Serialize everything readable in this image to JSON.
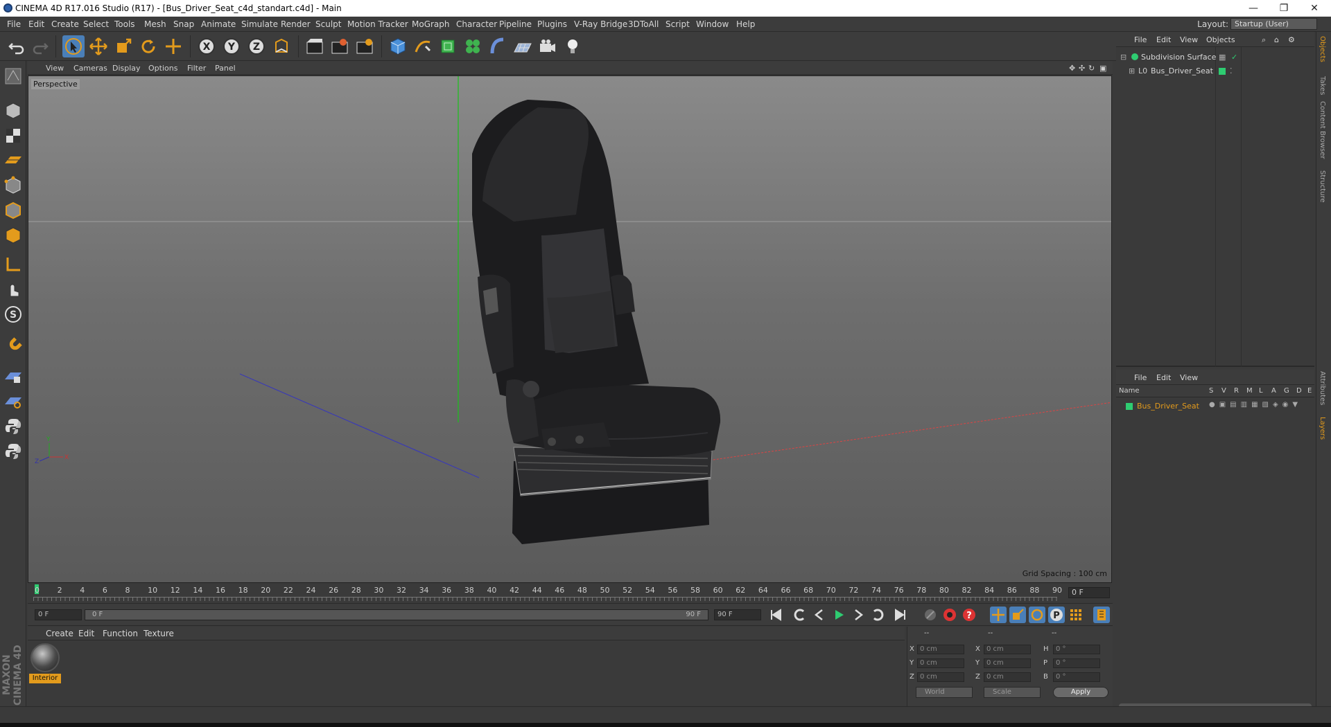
{
  "window": {
    "title": "CINEMA 4D R17.016 Studio (R17) - [Bus_Driver_Seat_c4d_standart.c4d] - Main",
    "minimize": "—",
    "maximize": "❐",
    "close": "✕"
  },
  "menubar": {
    "items": [
      "File",
      "Edit",
      "Create",
      "Select",
      "Tools",
      "Mesh",
      "Snap",
      "Animate",
      "Simulate",
      "Render",
      "Sculpt",
      "Motion Tracker",
      "MoGraph",
      "Character",
      "Pipeline",
      "Plugins",
      "V-Ray Bridge",
      "3DToAll",
      "Script",
      "Window",
      "Help"
    ],
    "layout_label": "Layout:",
    "layout_value": "Startup (User)"
  },
  "viewport": {
    "menu": [
      "View",
      "Cameras",
      "Display",
      "Options",
      "Filter",
      "Panel"
    ],
    "label": "Perspective",
    "grid_spacing": "Grid Spacing : 100 cm",
    "axis_labels": {
      "x": "X",
      "y": "Y",
      "z": "Z"
    }
  },
  "timeline": {
    "ticks": [
      "0",
      "2",
      "4",
      "6",
      "8",
      "10",
      "12",
      "14",
      "16",
      "18",
      "20",
      "22",
      "24",
      "26",
      "28",
      "30",
      "32",
      "34",
      "36",
      "38",
      "40",
      "42",
      "44",
      "46",
      "48",
      "50",
      "52",
      "54",
      "56",
      "58",
      "60",
      "62",
      "64",
      "66",
      "68",
      "70",
      "72",
      "74",
      "76",
      "78",
      "80",
      "82",
      "84",
      "86",
      "88",
      "90"
    ],
    "current_frame": "0 F"
  },
  "transport": {
    "start_field": "0 F",
    "slider_start": "0 F",
    "slider_end": "90 F",
    "end_field": "90 F"
  },
  "material_manager": {
    "menu": [
      "Create",
      "Edit",
      "Function",
      "Texture"
    ],
    "materials": [
      {
        "name": "Interior"
      }
    ]
  },
  "coordinates": {
    "header_dashes": [
      "--",
      "--",
      "--"
    ],
    "rows": [
      {
        "a": "X",
        "av": "0 cm",
        "b": "X",
        "bv": "0 cm",
        "c": "H",
        "cv": "0 °"
      },
      {
        "a": "Y",
        "av": "0 cm",
        "b": "Y",
        "bv": "0 cm",
        "c": "P",
        "cv": "0 °"
      },
      {
        "a": "Z",
        "av": "0 cm",
        "b": "Z",
        "bv": "0 cm",
        "c": "B",
        "cv": "0 °"
      }
    ],
    "world": "World",
    "scale": "Scale",
    "apply": "Apply"
  },
  "object_manager": {
    "menu": [
      "File",
      "Edit",
      "View",
      "Objects"
    ],
    "objects": [
      {
        "name": "Subdivision Surface"
      },
      {
        "name": "Bus_Driver_Seat"
      }
    ]
  },
  "layer_manager": {
    "menu": [
      "File",
      "Edit",
      "View"
    ],
    "columns": {
      "name": "Name",
      "flags": [
        "S",
        "V",
        "R",
        "M",
        "L",
        "A",
        "G",
        "D",
        "E"
      ]
    },
    "layers": [
      {
        "name": "Bus_Driver_Seat",
        "color": "#2ecc71"
      }
    ]
  },
  "side_tabs": [
    "Objects",
    "Takes",
    "Content Browser",
    "Structure",
    "Attributes",
    "Layers"
  ],
  "brand": "MAXON CINEMA 4D",
  "colors": {
    "accent": "#e39b1c",
    "green": "#2ecc71",
    "blue_btn": "#4a7fb8"
  }
}
